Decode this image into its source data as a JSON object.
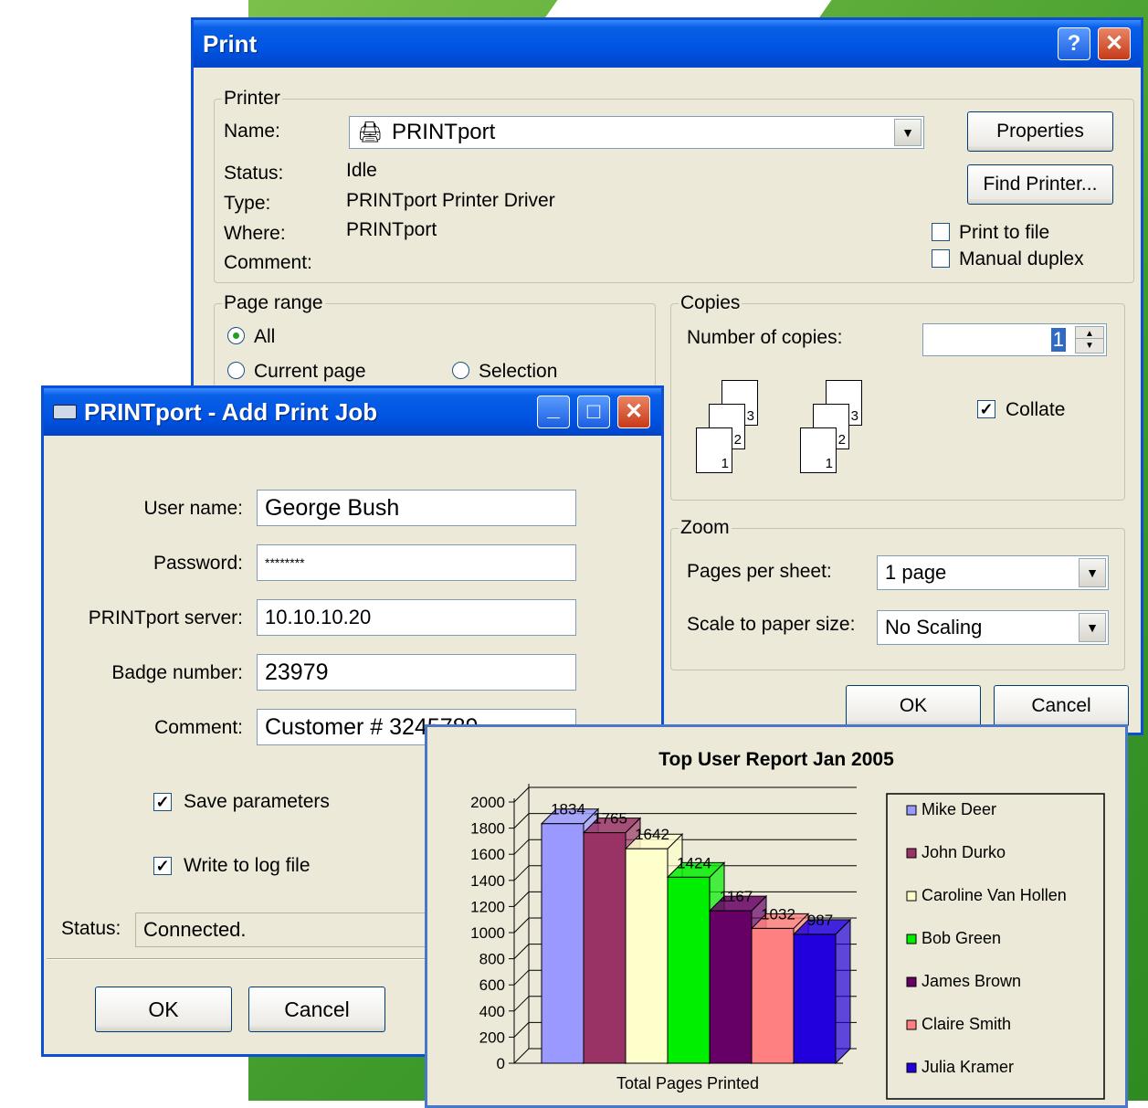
{
  "print_dialog": {
    "title": "Print",
    "help_btn": "?",
    "close_btn": "✕",
    "printer_group": "Printer",
    "name_label": "Name:",
    "name_value": "PRINTport",
    "status_label": "Status:",
    "status_value": "Idle",
    "type_label": "Type:",
    "type_value": "PRINTport Printer Driver",
    "where_label": "Where:",
    "where_value": "PRINTport",
    "comment_label": "Comment:",
    "properties_btn": "Properties",
    "find_printer_btn": "Find Printer...",
    "print_to_file": "Print to file",
    "manual_duplex": "Manual duplex",
    "page_range_group": "Page range",
    "all": "All",
    "current_page": "Current page",
    "selection": "Selection",
    "copies_group": "Copies",
    "number_of_copies_label": "Number of copies:",
    "number_of_copies_value": "1",
    "collate": "Collate",
    "zoom_group": "Zoom",
    "pages_per_sheet_label": "Pages per sheet:",
    "pages_per_sheet_value": "1 page",
    "scale_label": "Scale to paper size:",
    "scale_value": "No Scaling",
    "ok_btn": "OK",
    "cancel_btn": "Cancel"
  },
  "add_job_dialog": {
    "title": "PRINTport - Add Print Job",
    "min_btn": "_",
    "max_btn": "□",
    "close_btn": "✕",
    "user_name_label": "User name:",
    "user_name_value": "George Bush",
    "password_label": "Password:",
    "password_value": "********",
    "server_label": "PRINTport server:",
    "server_value": "10.10.10.20",
    "badge_label": "Badge number:",
    "badge_value": "23979",
    "comment_label": "Comment:",
    "comment_value": "Customer # 3245789",
    "save_parameters": "Save parameters",
    "write_log": "Write to log file",
    "status_label": "Status:",
    "status_value": "Connected.",
    "ok_btn": "OK",
    "cancel_btn": "Cancel"
  },
  "chart_data": {
    "type": "bar",
    "title": "Top User Report Jan 2005",
    "xlabel": "Total Pages Printed",
    "ylabel": "",
    "ylim": [
      0,
      2000
    ],
    "yticks": [
      0,
      200,
      400,
      600,
      800,
      1000,
      1200,
      1400,
      1600,
      1800,
      2000
    ],
    "legend_position": "right",
    "series": [
      {
        "name": "Mike Deer",
        "value": 1834,
        "color": "#9999ff"
      },
      {
        "name": "John Durko",
        "value": 1765,
        "color": "#993366"
      },
      {
        "name": "Caroline Van Hollen",
        "value": 1642,
        "color": "#ffffcc"
      },
      {
        "name": "Bob Green",
        "value": 1424,
        "color": "#00ee00"
      },
      {
        "name": "James Brown",
        "value": 1167,
        "color": "#660066"
      },
      {
        "name": "Claire Smith",
        "value": 1032,
        "color": "#ff8080"
      },
      {
        "name": "Julia Kramer",
        "value": 987,
        "color": "#2200dd"
      }
    ]
  }
}
